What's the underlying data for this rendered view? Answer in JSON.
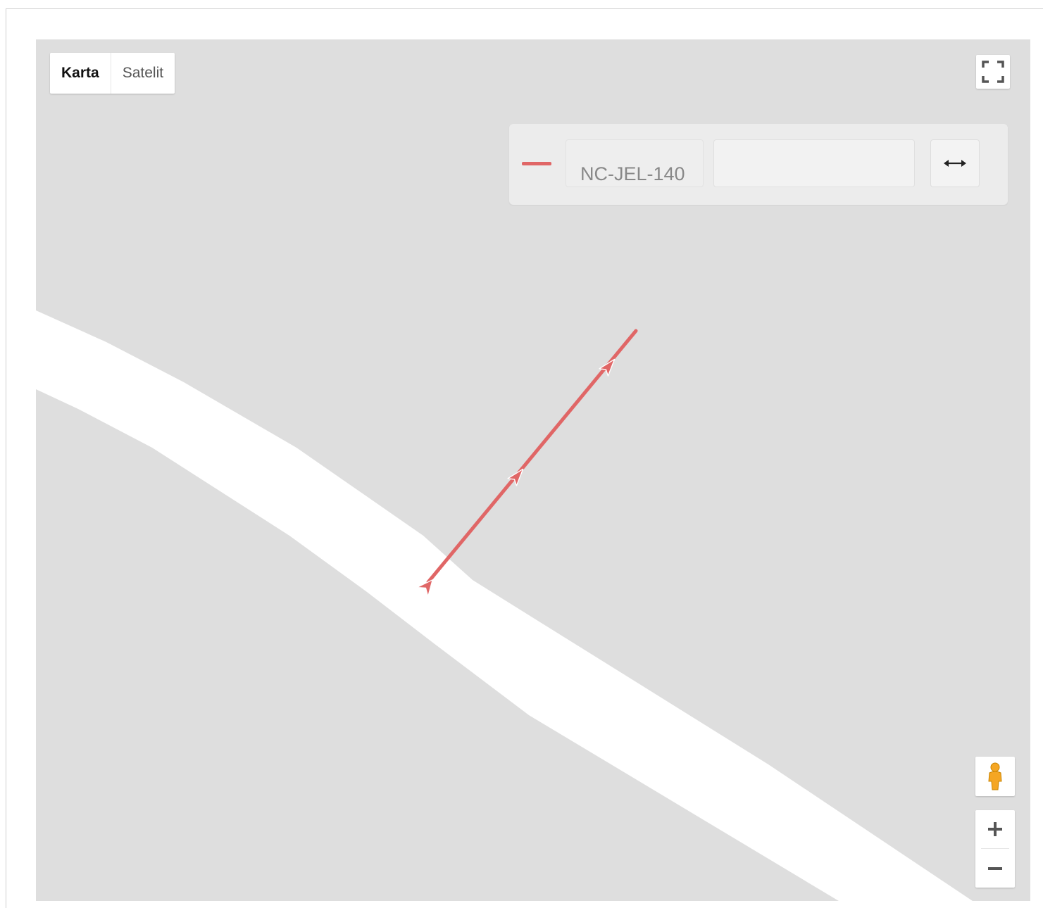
{
  "map": {
    "type_control": {
      "options": [
        {
          "label": "Karta",
          "active": true
        },
        {
          "label": "Satelit",
          "active": false
        }
      ]
    },
    "fullscreen": {
      "icon": "fullscreen-icon"
    },
    "route_panel": {
      "line_color": "#e06666",
      "code": "NC-JEL-140",
      "field_value": "",
      "swap_icon": "double-arrow-horizontal-icon"
    },
    "street_view": {
      "icon": "pegman-icon",
      "color": "#f5a623"
    },
    "zoom": {
      "in_label": "+",
      "out_label": "−"
    },
    "colors": {
      "background": "#dedede",
      "road": "#ffffff",
      "route": "#e06666"
    }
  }
}
